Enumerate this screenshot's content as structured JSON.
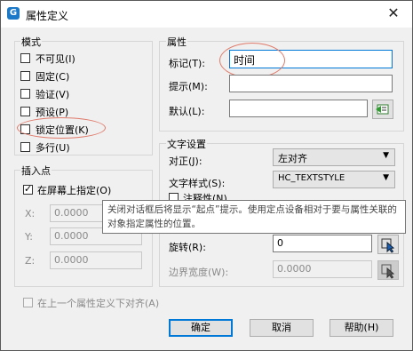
{
  "window": {
    "title": "属性定义",
    "icon": "app-logo-icon"
  },
  "mode": {
    "label": "模式",
    "items": [
      {
        "label": "不可见(I)",
        "checked": false
      },
      {
        "label": "固定(C)",
        "checked": false
      },
      {
        "label": "验证(V)",
        "checked": false
      },
      {
        "label": "预设(P)",
        "checked": false
      },
      {
        "label": "锁定位置(K)",
        "checked": false
      },
      {
        "label": "多行(U)",
        "checked": false
      }
    ]
  },
  "insert": {
    "label": "插入点",
    "on_screen": {
      "label": "在屏幕上指定(O)",
      "checked": true
    },
    "x": {
      "label": "X:",
      "value": "0.0000"
    },
    "y": {
      "label": "Y:",
      "value": "0.0000"
    },
    "z": {
      "label": "Z:",
      "value": "0.0000"
    }
  },
  "attribute": {
    "label": "属性",
    "tag": {
      "label": "标记(T):",
      "value": "时间"
    },
    "prompt": {
      "label": "提示(M):",
      "value": ""
    },
    "default": {
      "label": "默认(L):",
      "value": ""
    }
  },
  "text": {
    "label": "文字设置",
    "justify": {
      "label": "对正(J):",
      "value": "左对齐"
    },
    "style": {
      "label": "文字样式(S):",
      "value": "HC_TEXTSTYLE"
    },
    "annotative": {
      "label": "注释性(N)"
    },
    "rotation": {
      "label": "旋转(R):",
      "value": "0"
    },
    "boundary": {
      "label": "边界宽度(W):",
      "value": "0.0000"
    }
  },
  "align_below": {
    "label": "在上一个属性定义下对齐(A)",
    "checked": false
  },
  "tooltip": {
    "text": "关闭对话框后将显示“起点”提示。使用定点设备相对于要与属性关联的对象指定属性的位置。"
  },
  "buttons": {
    "ok": "确定",
    "cancel": "取消",
    "help": "帮助(H)"
  }
}
